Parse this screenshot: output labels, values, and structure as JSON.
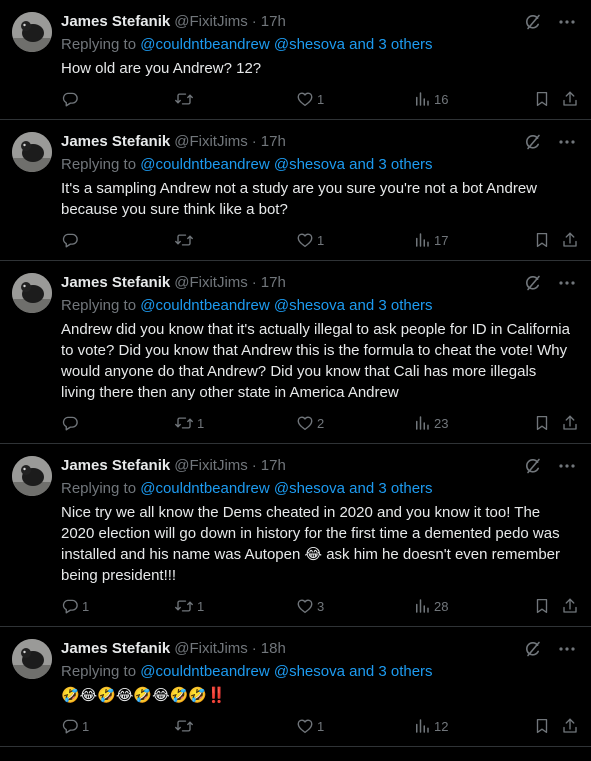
{
  "colors": {
    "background": "#000000",
    "text": "#e7e9ea",
    "muted": "#71767b",
    "link": "#1d9bf0",
    "divider": "#2f3336"
  },
  "icons": {
    "reply": "reply-icon",
    "retweet": "retweet-icon",
    "like": "heart-icon",
    "views": "views-chart-icon",
    "bookmark": "bookmark-icon",
    "share": "share-icon",
    "grok": "grok-icon",
    "more": "more-icon"
  },
  "tweets": [
    {
      "name": "James Stefanik",
      "handle": "@FixitJims",
      "sep": "·",
      "time": "17h",
      "replying_prefix": "Replying to",
      "mentions": "@couldntbeandrew @shesova",
      "and": "and",
      "others": "3 others",
      "text": "How old are you Andrew? 12?",
      "reply_count": "",
      "retweet_count": "",
      "like_count": "1",
      "views": "16"
    },
    {
      "name": "James Stefanik",
      "handle": "@FixitJims",
      "sep": "·",
      "time": "17h",
      "replying_prefix": "Replying to",
      "mentions": "@couldntbeandrew @shesova",
      "and": "and",
      "others": "3 others",
      "text": "It's a sampling Andrew not a study are you sure you're not a bot Andrew because you sure think like a bot?",
      "reply_count": "",
      "retweet_count": "",
      "like_count": "1",
      "views": "17"
    },
    {
      "name": "James Stefanik",
      "handle": "@FixitJims",
      "sep": "·",
      "time": "17h",
      "replying_prefix": "Replying to",
      "mentions": "@couldntbeandrew @shesova",
      "and": "and",
      "others": "3 others",
      "text": "Andrew did you know that it's actually illegal to ask people for ID in California to vote? Did you know that Andrew this is the formula to cheat the vote! Why would anyone do that Andrew? Did you know that Cali has more illegals living there then any other state in America Andrew",
      "reply_count": "",
      "retweet_count": "1",
      "like_count": "2",
      "views": "23"
    },
    {
      "name": "James Stefanik",
      "handle": "@FixitJims",
      "sep": "·",
      "time": "17h",
      "replying_prefix": "Replying to",
      "mentions": "@couldntbeandrew @shesova",
      "and": "and",
      "others": "3 others",
      "text": "Nice try we all know the Dems cheated in 2020 and you know it too! The 2020 election will go down in history for the first time a demented pedo was installed and his name was Autopen 😂 ask him he doesn't even remember being president!!!",
      "reply_count": "1",
      "retweet_count": "1",
      "like_count": "3",
      "views": "28"
    },
    {
      "name": "James Stefanik",
      "handle": "@FixitJims",
      "sep": "·",
      "time": "18h",
      "replying_prefix": "Replying to",
      "mentions": "@couldntbeandrew @shesova",
      "and": "and",
      "others": "3 others",
      "text": "🤣😂🤣😂🤣😂🤣🤣‼️",
      "reply_count": "1",
      "retweet_count": "",
      "like_count": "1",
      "views": "12"
    }
  ]
}
